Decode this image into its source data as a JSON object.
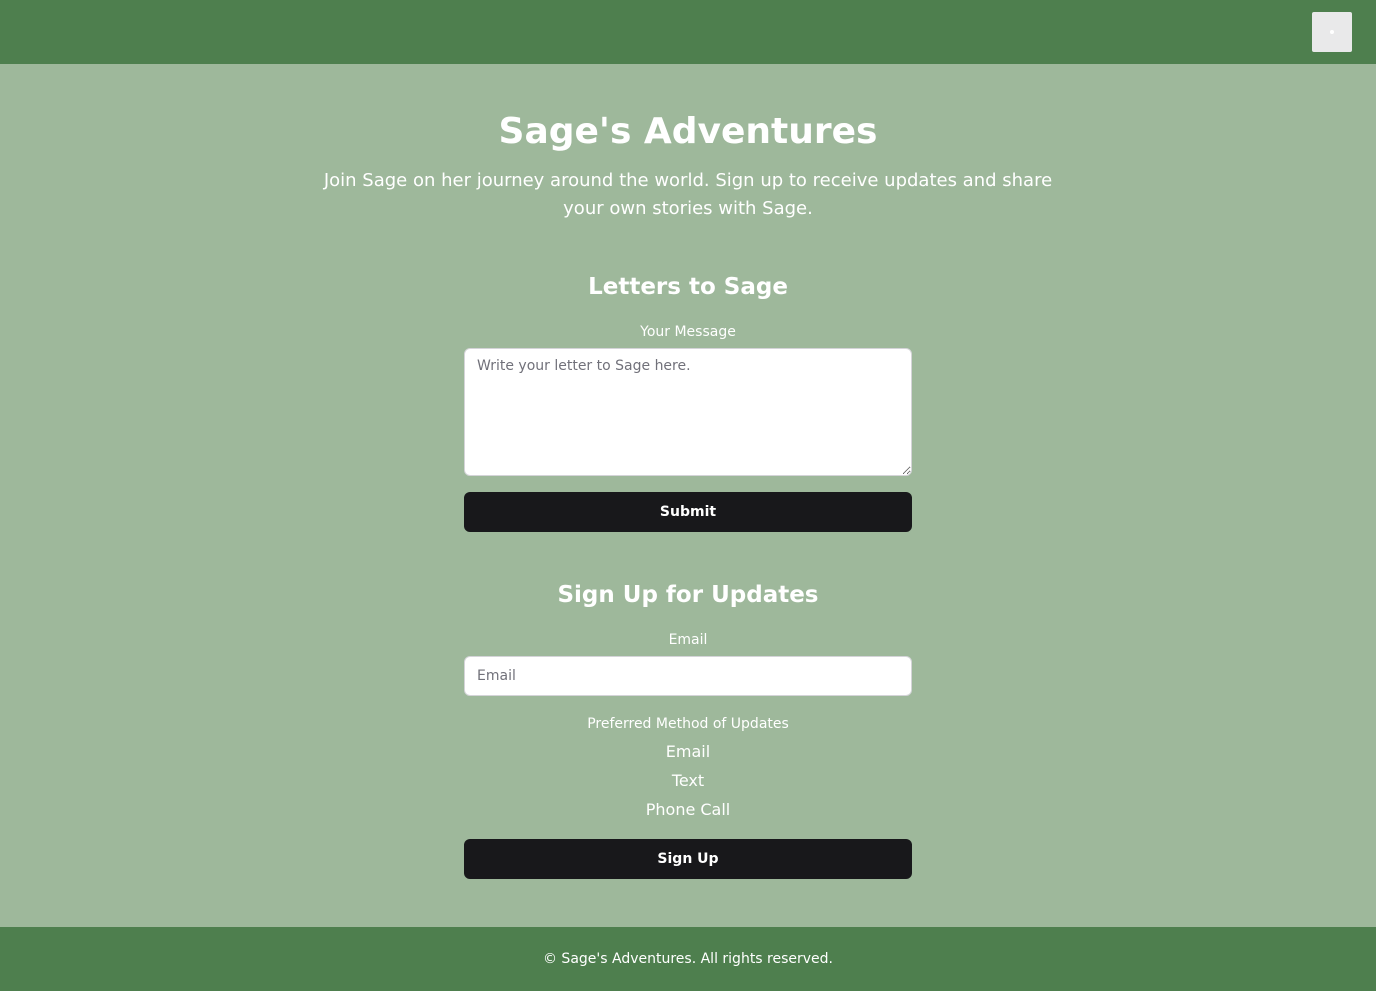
{
  "header": {
    "menu_icon": "menu-icon"
  },
  "hero": {
    "title": "Sage's Adventures",
    "subtitle": "Join Sage on her journey around the world. Sign up to receive updates and share your own stories with Sage."
  },
  "letters": {
    "title": "Letters to Sage",
    "message_label": "Your Message",
    "message_placeholder": "Write your letter to Sage here.",
    "message_value": "",
    "submit_label": "Submit"
  },
  "signup": {
    "title": "Sign Up for Updates",
    "email_label": "Email",
    "email_placeholder": "Email",
    "email_value": "",
    "method_label": "Preferred Method of Updates",
    "methods": [
      "Email",
      "Text",
      "Phone Call"
    ],
    "button_label": "Sign Up"
  },
  "footer": {
    "text": "© Sage's Adventures. All rights reserved."
  },
  "colors": {
    "header_bg": "#4e7f4e",
    "page_bg": "#9eb89b",
    "button_bg": "#18181b",
    "text": "#ffffff"
  }
}
